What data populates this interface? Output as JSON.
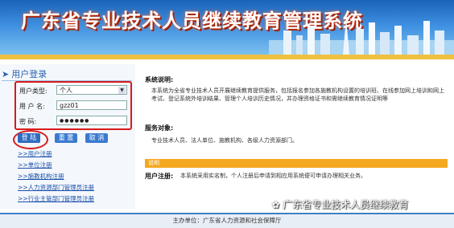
{
  "banner": {
    "title": "广东省专业技术人员继续教育管理系统"
  },
  "login": {
    "heading": "用户登录",
    "user_type_label": "用户类型:",
    "user_type_value": "个人",
    "username_label": "用 户 名:",
    "username_value": "gzz01",
    "password_label": "密   码:",
    "password_mask": "●●●●●●",
    "login_button": "登 陆",
    "reset_button": "重 置",
    "cancel_button": "取 消"
  },
  "links": [
    ">>用户注册",
    ">>单位注册",
    ">>施教机构注册",
    ">>人力资源部门管理员注册",
    ">>行业主管部门管理员注册"
  ],
  "info": {
    "system_heading": "系统说明:",
    "system_text": "本系统为全省专业技术人员开展继续教育提供服务，包括报名参加各施教机构设置的培训班、在线参加网上培训和网上考试、登记系统外培训结果、管理个人培训历史情况，并办理资格证书和需继续教育情况证明等",
    "service_heading": "服务对象:",
    "service_text": "专业技术人员、法人单位、施教机构、各级人力资源部门。",
    "notes_bar": "说明",
    "register_heading": "用户注册:",
    "register_text": "本系统采用实名制，个人注册后申请到相应用系统便可申请办理相关业务。"
  },
  "footer": {
    "text": "主办单位：广东省人力资源和社会保障厅"
  },
  "watermark": {
    "text": "广东省专业技术人员继续教育"
  }
}
